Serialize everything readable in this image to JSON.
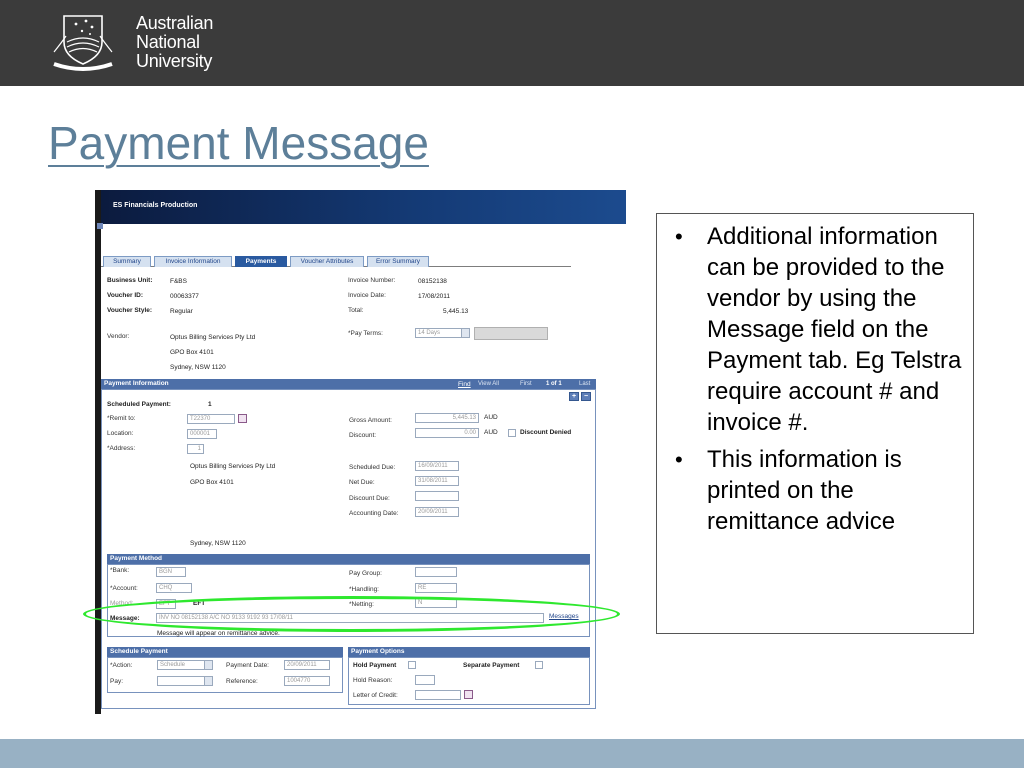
{
  "header": {
    "logo_lines": [
      "Australian",
      "National",
      "University"
    ]
  },
  "slide": {
    "title": "Payment Message",
    "notes": [
      "Additional information can be provided to the vendor by using the Message field on the Payment tab. Eg Telstra require account # and invoice #.",
      "This information is printed on the remittance advice"
    ]
  },
  "screenshot": {
    "app_title": "ES Financials Production",
    "tabs": [
      "Summary",
      "Invoice Information",
      "Payments",
      "Voucher Attributes",
      "Error Summary"
    ],
    "active_tab": "Payments",
    "business_unit": {
      "label": "Business Unit:",
      "value": "F&BS"
    },
    "voucher_id": {
      "label": "Voucher ID:",
      "value": "00063377"
    },
    "voucher_style": {
      "label": "Voucher Style:",
      "value": "Regular"
    },
    "vendor": {
      "label": "Vendor:",
      "lines": [
        "Optus Billing Services Pty Ltd",
        "GPO Box 4101",
        "Sydney, NSW  1120"
      ]
    },
    "invoice_number": {
      "label": "Invoice Number:",
      "value": "08152138"
    },
    "invoice_date": {
      "label": "Invoice Date:",
      "value": "17/08/2011"
    },
    "total": {
      "label": "Total:",
      "value": "5,445.13"
    },
    "pay_terms": {
      "label": "*Pay Terms:",
      "value": "14 Days"
    },
    "payment_information": {
      "header": "Payment Information",
      "nav": {
        "find": "Find",
        "view_all": "View All",
        "first": "First",
        "count": "1 of 1",
        "last": "Last"
      },
      "scheduled_payment_label": "Scheduled Payment:",
      "scheduled_payment_value": "1",
      "remit_to_label": "*Remit to:",
      "remit_to_value": "T22370",
      "location_label": "Location:",
      "location_value": "000001",
      "address_label": "*Address:",
      "address_value": "1",
      "address_lines": [
        "Optus Billing Services Pty Ltd",
        "GPO Box 4101",
        "Sydney, NSW  1120"
      ],
      "gross_amount_label": "Gross Amount:",
      "gross_amount_value": "5,445.13",
      "currency": "AUD",
      "discount_label": "Discount:",
      "discount_value": "0.00",
      "discount_denied_label": "Discount Denied",
      "scheduled_due_label": "Scheduled Due:",
      "scheduled_due_value": "16/09/2011",
      "net_due_label": "Net Due:",
      "net_due_value": "31/08/2011",
      "discount_due_label": "Discount Due:",
      "accounting_date_label": "Accounting Date:",
      "accounting_date_value": "20/09/2011"
    },
    "payment_method": {
      "header": "Payment Method",
      "bank_label": "*Bank:",
      "bank_value": "BGN",
      "account_label": "*Account:",
      "account_value": "CHQ",
      "method_label": "Method:",
      "method_value": "EFT",
      "method_display": "EFT",
      "pay_group_label": "Pay Group:",
      "handling_label": "*Handling:",
      "handling_value": "RE",
      "netting_label": "*Netting:",
      "netting_value": "N",
      "message_label": "Message:",
      "message_value": "INV NO 08152138 A/C NO 9133 9192 93 17/08/11",
      "messages_link": "Messages",
      "message_note": "Message will appear on remittance advice."
    },
    "schedule_payment": {
      "header": "Schedule Payment",
      "action_label": "*Action:",
      "action_value": "Schedule",
      "payment_date_label": "Payment Date:",
      "payment_date_value": "20/09/2011",
      "pay_label": "Pay:",
      "reference_label": "Reference:",
      "reference_value": "1004770"
    },
    "payment_options": {
      "header": "Payment Options",
      "hold_payment_label": "Hold Payment",
      "separate_payment_label": "Separate Payment",
      "hold_reason_label": "Hold Reason:",
      "letter_of_credit_label": "Letter of Credit:"
    }
  }
}
